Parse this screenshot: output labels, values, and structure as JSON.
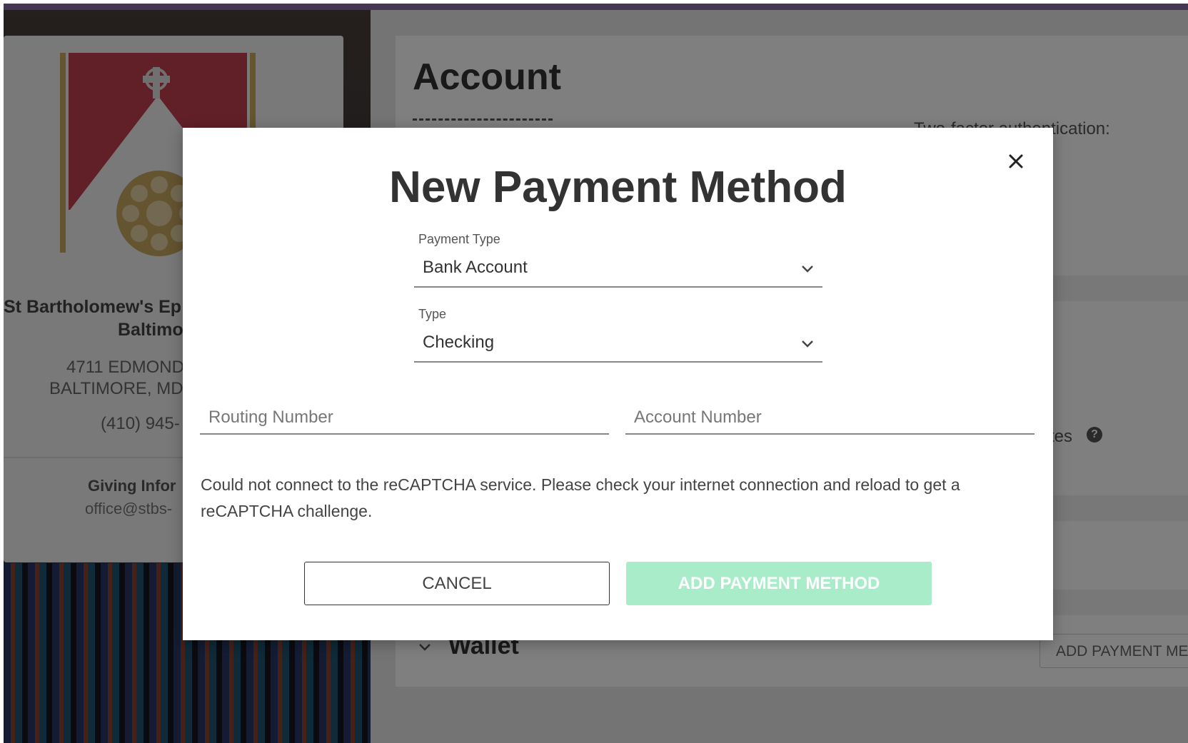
{
  "background": {
    "church": {
      "name_line1": "St Bartholomew's Ep",
      "name_line2": "Baltimo",
      "address_line1": "4711 EDMOND",
      "address_line2": "BALTIMORE, MD",
      "phone": "(410) 945-",
      "giving_title": "Giving Infor",
      "giving_email": "office@stbs-"
    },
    "account": {
      "title": "Account",
      "two_factor_label": "Two-factor authentication:",
      "notifications_label_fragment": "tes",
      "help_icon_glyph": "?",
      "wallet_title": "Wallet",
      "add_payment_button": "ADD PAYMENT ME"
    }
  },
  "modal": {
    "title": "New Payment Method",
    "payment_type": {
      "label": "Payment Type",
      "value": "Bank Account"
    },
    "account_type": {
      "label": "Type",
      "value": "Checking"
    },
    "routing_number": {
      "placeholder": "Routing Number",
      "value": ""
    },
    "account_number": {
      "placeholder": "Account Number",
      "value": ""
    },
    "recaptcha_message": "Could not connect to the reCAPTCHA service. Please check your internet connection and reload to get a reCAPTCHA challenge.",
    "cancel_label": "CANCEL",
    "submit_label": "ADD PAYMENT METHOD",
    "colors": {
      "submit_disabled": "#a9ecc9",
      "title_text": "#333333"
    },
    "icons": {
      "close": "close-icon",
      "dropdown": "chevron-down-icon"
    }
  }
}
